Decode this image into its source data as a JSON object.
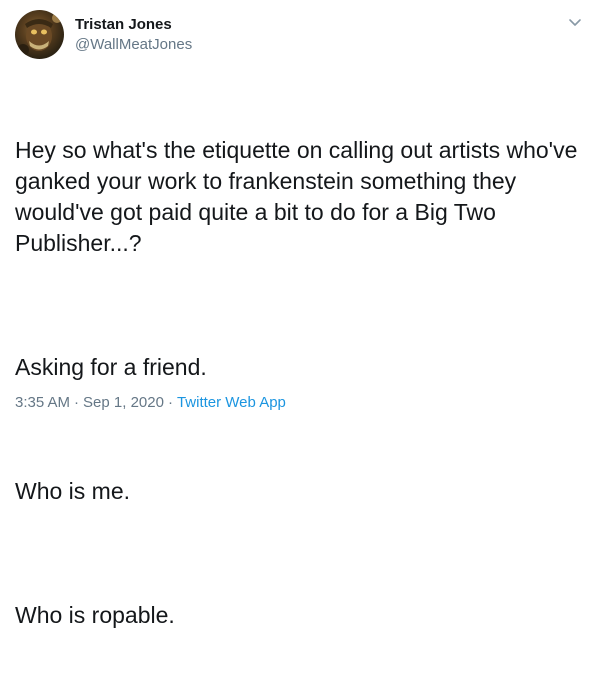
{
  "author": {
    "display_name": "Tristan Jones",
    "handle": "@WallMeatJones"
  },
  "icons": {
    "avatar": "avatar-image",
    "menu": "chevron-down-icon"
  },
  "tweet": {
    "paragraphs": [
      "Hey so what's the etiquette on calling out artists who've ganked your work to frankenstein something they would've got paid quite a bit to do for a Big Two Publisher...?",
      "Asking for a friend.",
      "Who is me.",
      "Who is ropable."
    ],
    "time": "3:35 AM",
    "separator": "·",
    "date": "Sep 1, 2020",
    "source": "Twitter Web App"
  },
  "colors": {
    "text": "#14171a",
    "secondary": "#657786",
    "link": "#1b95e0"
  }
}
